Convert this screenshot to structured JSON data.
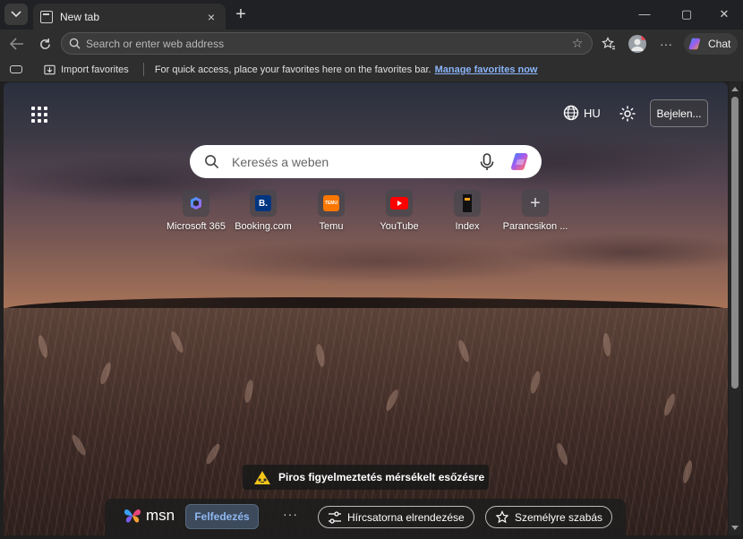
{
  "tab": {
    "title": "New tab",
    "close_icon": "×",
    "new_tab_icon": "+"
  },
  "window_controls": {
    "minimize": "—",
    "maximize": "▢",
    "close": "✕"
  },
  "address_bar": {
    "placeholder": "Search or enter web address",
    "value": ""
  },
  "toolbar": {
    "more_label": "···",
    "chat_label": "Chat"
  },
  "favorites_bar": {
    "import_label": "Import favorites",
    "message": "For quick access, place your favorites here on the favorites bar.",
    "manage_link": "Manage favorites now"
  },
  "header": {
    "language": "HU",
    "signin_label": "Bejelen..."
  },
  "search": {
    "placeholder": "Keresés a weben",
    "value": ""
  },
  "quick_links": [
    {
      "label": "Microsoft 365",
      "icon": "microsoft365-icon"
    },
    {
      "label": "Booking.com",
      "icon": "booking-icon",
      "glyph": "B."
    },
    {
      "label": "Temu",
      "icon": "temu-icon",
      "glyph": "TEMU"
    },
    {
      "label": "YouTube",
      "icon": "youtube-icon"
    },
    {
      "label": "Index",
      "icon": "index-icon"
    },
    {
      "label": "Parancsikon ...",
      "icon": "add-shortcut-icon",
      "glyph": "+"
    }
  ],
  "alert": {
    "text": "Piros figyelmeztetés mérsékelt esőzésre"
  },
  "msn_bar": {
    "logo": "msn",
    "explore_label": "Felfedezés",
    "more_label": "···",
    "layout_label": "Hírcsatorna elrendezése",
    "personalize_label": "Személyre szabás"
  },
  "colors": {
    "accent_link": "#8ab4f8",
    "chrome_bg": "#2e2e2e",
    "tabstrip_bg": "#202124",
    "alert_icon": "#f5c518"
  }
}
